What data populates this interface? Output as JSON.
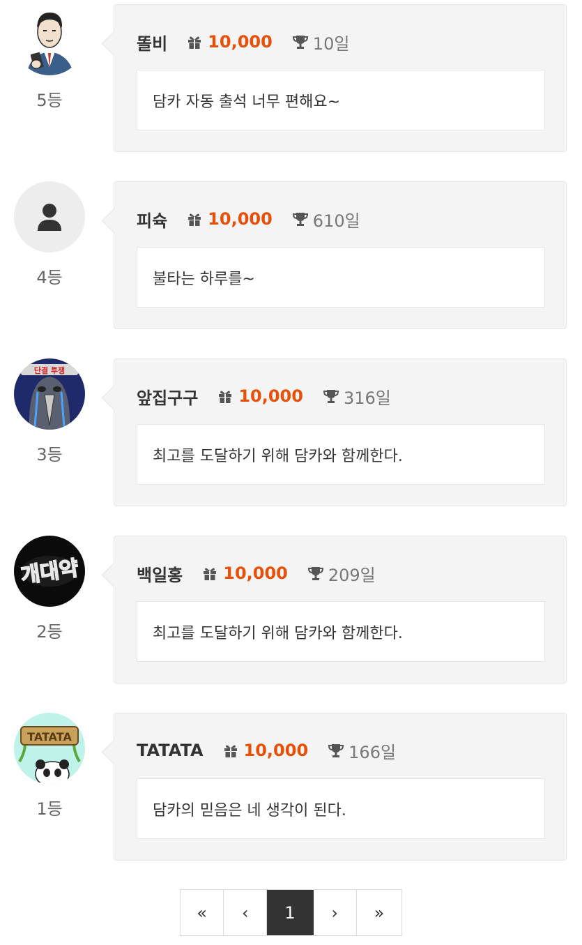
{
  "entries": [
    {
      "rank": "5등",
      "nickname": "똘비",
      "points": "10,000",
      "days": "10일",
      "message": "담카 자동 출석 너무 편해요~",
      "avatar": "businessman-phone-avatar"
    },
    {
      "rank": "4등",
      "nickname": "피슉",
      "points": "10,000",
      "days": "610일",
      "message": "불타는 하루를~",
      "avatar": "default-user-icon"
    },
    {
      "rank": "3등",
      "nickname": "앞집구구",
      "points": "10,000",
      "days": "316일",
      "message": "최고를 도달하기 위해 담카와 함께한다.",
      "avatar": "crying-bird-avatar",
      "avatar_text": "단결 투쟁"
    },
    {
      "rank": "2등",
      "nickname": "백일홍",
      "points": "10,000",
      "days": "209일",
      "message": "최고를 도달하기 위해 담카와 함께한다.",
      "avatar": "neon-sign-avatar",
      "avatar_text": "개대약"
    },
    {
      "rank": "1등",
      "nickname": "TATATA",
      "points": "10,000",
      "days": "166일",
      "message": "담카의 믿음은 네 생각이 된다.",
      "avatar": "panda-sign-avatar",
      "avatar_text": "TATATA"
    }
  ],
  "pagination": {
    "first": "«",
    "prev": "‹",
    "current": "1",
    "next": "›",
    "last": "»"
  },
  "colors": {
    "points": "#e8500a",
    "card_bg": "#f4f4f4",
    "active_page_bg": "#333333"
  },
  "icons": {
    "points": "gift-icon",
    "days": "trophy-icon"
  }
}
